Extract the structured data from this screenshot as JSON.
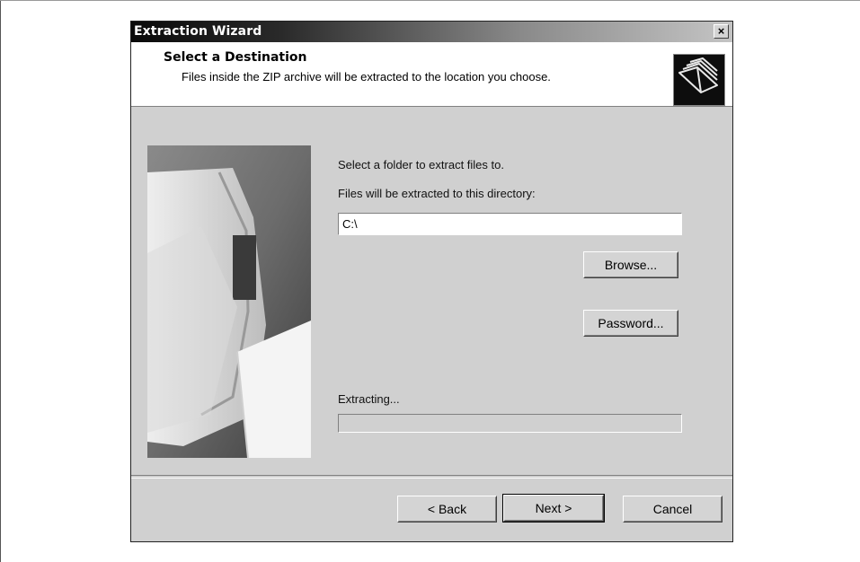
{
  "window": {
    "title": "Extraction Wizard",
    "close_glyph": "×"
  },
  "header": {
    "title": "Select a Destination",
    "subtitle": "Files inside the ZIP archive will be extracted to the location you choose.",
    "icon": "folders-icon"
  },
  "main": {
    "instruction": "Select a folder to extract files to.",
    "directory_label": "Files will be extracted to this directory:",
    "directory_value": "C:\\",
    "browse_label": "Browse...",
    "password_label": "Password...",
    "progress_label": "Extracting...",
    "progress": 0
  },
  "footer": {
    "back_label": "< Back",
    "next_label": "Next >",
    "cancel_label": "Cancel"
  },
  "colors": {
    "dialog_face": "#d0d0d0",
    "titlebar_dark": "#0a0a0a",
    "titlebar_light": "#c4c4c4",
    "header_bg": "#ffffff"
  }
}
